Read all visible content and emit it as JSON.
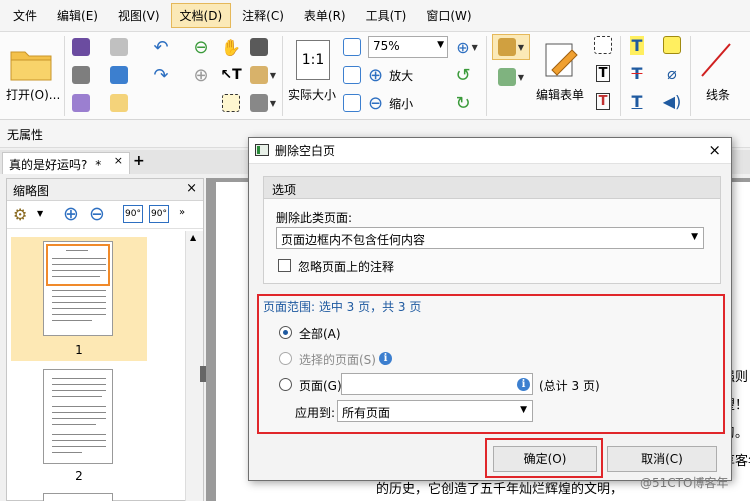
{
  "menu": [
    "文件",
    "编辑(E)",
    "视图(V)",
    "文档(D)",
    "注释(C)",
    "表单(R)",
    "工具(T)",
    "窗口(W)"
  ],
  "ribbon": {
    "open_label": "打开(O)...",
    "zoom_value": "75%",
    "actual_size_label": "实际大小",
    "zoom_in_label": "放大",
    "zoom_out_label": "缩小",
    "edit_form_label": "编辑表单",
    "line_label": "线条"
  },
  "properties_label": "无属性",
  "doc_tab": {
    "title": "真的是好运吗?",
    "modified": "*",
    "add": "+"
  },
  "thumbnails": {
    "title": "缩略图",
    "close": "×",
    "pages": [
      {
        "number": "1",
        "selected": true
      },
      {
        "number": "2",
        "selected": false
      }
    ]
  },
  "document": {
    "fragments": [
      "强则",
      "望！",
      "习。",
      "享客年",
      "的历史，它创造了五千年灿烂辉煌的文明，"
    ]
  },
  "dialog": {
    "title": "删除空白页",
    "close": "×",
    "options_header": "选项",
    "delete_type_label": "删除此类页面:",
    "delete_type_value": "页面边框内不包含任何内容",
    "ignore_annotations_label": "忽略页面上的注释",
    "range_header": "页面范围: 选中 3 页，共 3 页",
    "range_all_label": "全部(A)",
    "range_selected_label": "选择的页面(S)",
    "range_pages_label": "页面(G)",
    "range_pages_value": "",
    "range_total": "(总计 3 页)",
    "apply_to_label": "应用到:",
    "apply_to_value": "所有页面",
    "ok_label": "确定(O)",
    "cancel_label": "取消(C)"
  },
  "watermark": "@51CTO博客年",
  "colors": {
    "accent": "#1f5aa0",
    "highlight": "#e0262a",
    "menu_active": "#fbe9b7"
  }
}
